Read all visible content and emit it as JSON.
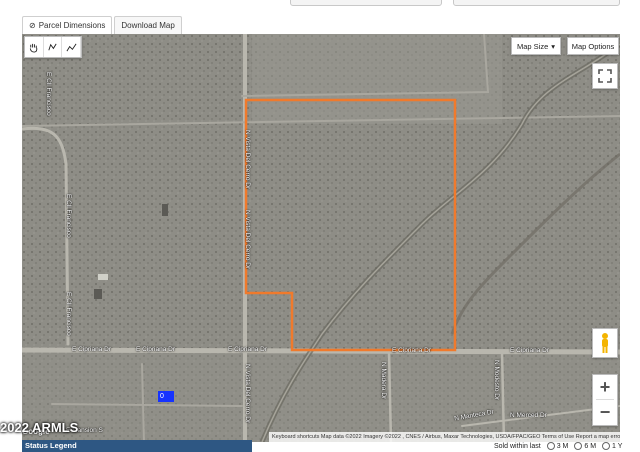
{
  "tabs": [
    {
      "label": "Parcel Dimensions",
      "icon": "no-entry-circle-icon"
    },
    {
      "label": "Download Map"
    }
  ],
  "map_controls": {
    "map_size_label": "Map Size",
    "map_options_label": "Map Options",
    "zoom_in": "+",
    "zoom_out": "−"
  },
  "roads": {
    "e_cipriana_1": "E Cipriana Dr",
    "e_cipriana_2": "E Cipriana Dr",
    "e_cipriana_3": "E Cipriana Dr",
    "e_cipriana_4": "E Cipriana Dr",
    "e_cipriana_5": "E Cipriana Dr",
    "n_vista_del_cerro_1": "N Vista Del Cerro Dr",
    "n_vista_del_cerro_2": "N Vista Del Cerro Dr",
    "n_vista_del_cerro_3": "N Vista Del Cerro Dr",
    "e_cll_francisco_1": "E Cll Francisco",
    "e_cll_francisco_2": "E Cll Francisco",
    "e_cll_francisco_3": "E Cll Francisco",
    "n_madera": "N Madera Dr",
    "n_modesto": "N Modesto Dr",
    "n_manteca": "N Manteca Dr",
    "n_merced": "N Merced Dr",
    "e_mansion": "E Mansion S"
  },
  "marker_label": "0",
  "attribution": "Keyboard shortcuts   Map data ©2022 Imagery ©2022 , CNES / Airbus, Maxar Technologies, USDA/FPAC/GEO   Terms of Use   Report a map error",
  "google_logo": "Google",
  "copyright": "2022 ARMLS",
  "status_legend": "Status Legend",
  "sold_within": {
    "label": "Sold within last",
    "options": [
      "3 M",
      "6 M",
      "1 Y"
    ]
  },
  "colors": {
    "parcel_outline": "#f07a2c",
    "road": "#b9b7ae",
    "terrain": "#8f8e87",
    "status_legend_bg": "#2e5783",
    "marker": "#1633ff"
  }
}
